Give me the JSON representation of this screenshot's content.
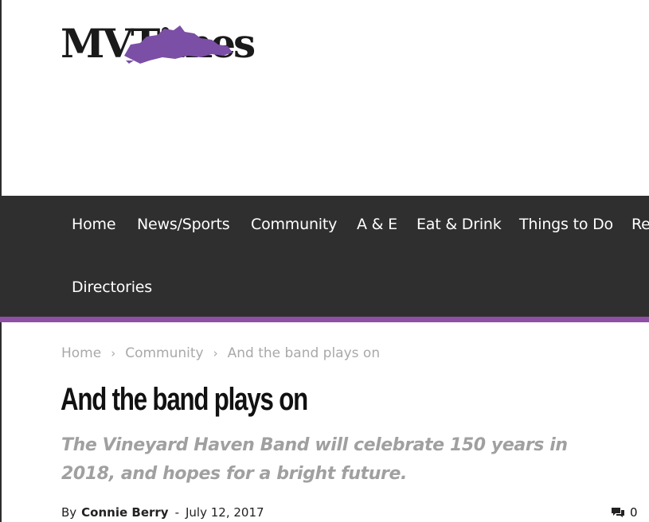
{
  "logo": {
    "text": "MVTimes"
  },
  "nav": {
    "items": [
      {
        "label": "Home"
      },
      {
        "label": "News/Sports"
      },
      {
        "label": "Community"
      },
      {
        "label": "A & E"
      },
      {
        "label": "Eat & Drink"
      },
      {
        "label": "Things to Do"
      },
      {
        "label": "Re"
      },
      {
        "label": "Directories"
      }
    ]
  },
  "breadcrumb": {
    "items": [
      "Home",
      "Community",
      "And the band plays on"
    ],
    "separator": "›"
  },
  "article": {
    "title": "And the band plays on",
    "subtitle": "The Vineyard Haven Band will celebrate 150 years in 2018, and hopes for a bright future.",
    "by_label": "By",
    "author": "Connie Berry",
    "dash": "-",
    "date": "July 12, 2017",
    "comment_count": "0"
  },
  "colors": {
    "nav_background": "#2f2f2f",
    "nav_accent": "#8e4fa4",
    "logo_purple": "#7b4fa6"
  }
}
